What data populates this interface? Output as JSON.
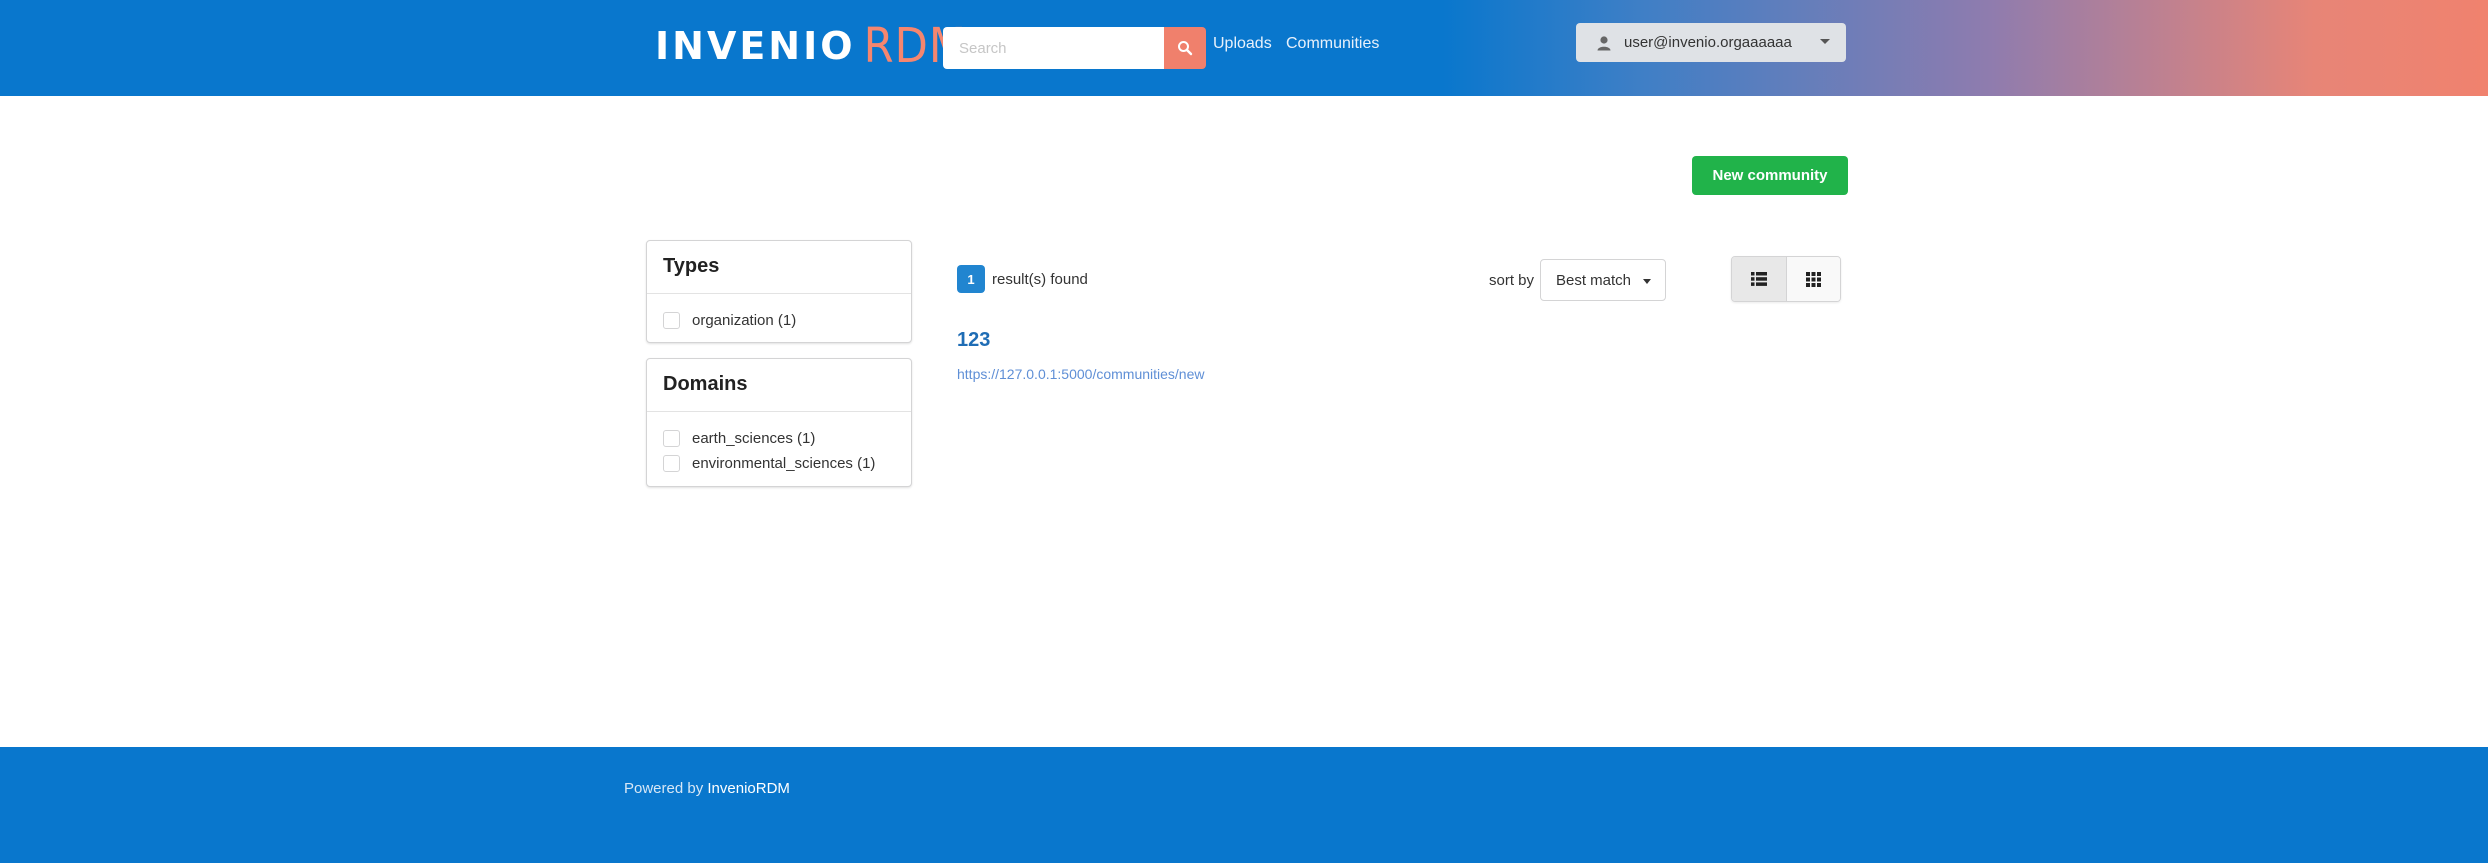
{
  "header": {
    "logo_primary": "INVENIO",
    "logo_secondary": "RDM",
    "search_placeholder": "Search",
    "search_icon": "search-icon",
    "nav": [
      {
        "label": "Uploads"
      },
      {
        "label": "Communities"
      }
    ],
    "user_email": "user@invenio.orgaaaaaa",
    "user_icon": "user-icon"
  },
  "actions": {
    "new_community_label": "New community"
  },
  "facets": {
    "types": {
      "title": "Types",
      "items": [
        {
          "label": "organization (1)"
        }
      ]
    },
    "domains": {
      "title": "Domains",
      "items": [
        {
          "label": "earth_sciences (1)"
        },
        {
          "label": "environmental_sciences (1)"
        }
      ]
    }
  },
  "results": {
    "count": "1",
    "count_label": "result(s) found",
    "sort_label": "sort by",
    "sort_value": "Best match",
    "view_options": [
      "list-view-icon",
      "grid-view-icon"
    ],
    "items": [
      {
        "title": "123",
        "url": "https://127.0.0.1:5000/communities/new"
      }
    ]
  },
  "footer": {
    "prefix": "Powered by",
    "link_label": "InvenioRDM"
  },
  "colors": {
    "header_blue": "#0977cd",
    "header_accent": "#f0826e",
    "primary_green": "#21b34a",
    "badge_blue": "#2185d0"
  }
}
